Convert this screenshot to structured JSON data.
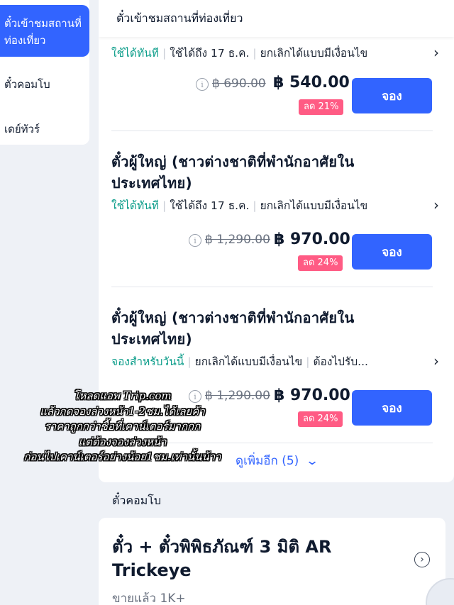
{
  "sidebar": {
    "items": [
      {
        "label": "ตั๋วเข้าชมสถานที่ท่องเที่ยว",
        "active": true
      },
      {
        "label": "ตั๋วคอมโบ"
      },
      {
        "label": "เดย์ทัวร์"
      }
    ]
  },
  "main": {
    "header": "ตั๋วเข้าชมสถานที่ท่องเที่ยว",
    "tickets": [
      {
        "title": "",
        "status": "ใช้ได้ทันที",
        "meta1": "ใช้ได้ถึง 17 ธ.ค.",
        "meta2": "ยกเลิกได้แบบมีเงื่อนไข",
        "old_price": "฿ 690.00",
        "new_price": "฿ 540.00",
        "discount": "ลด 21%",
        "button": "จอง"
      },
      {
        "title_line1": "ตั๋วผู้ใหญ่ (ชาวต่างชาติที่พำนักอาศัยใน",
        "title_line2": "ประเทศไทย)",
        "status": "ใช้ได้ทันที",
        "meta1": "ใช้ได้ถึง 17 ธ.ค.",
        "meta2": "ยกเลิกได้แบบมีเงื่อนไข",
        "old_price": "฿ 1,290.00",
        "new_price": "฿ 970.00",
        "discount": "ลด 24%",
        "button": "จอง"
      },
      {
        "title_line1": "ตั๋วผู้ใหญ่ (ชาวต่างชาติที่พำนักอาศัยใน",
        "title_line2": "ประเทศไทย)",
        "status": "จองสำหรับวันนี้",
        "meta1": "ยกเลิกได้แบบมีเงื่อนไข",
        "meta2": "ต้องไปรับ...",
        "old_price": "฿ 1,290.00",
        "new_price": "฿ 970.00",
        "discount": "ลด 24%",
        "button": "จอง"
      }
    ],
    "more": "ดูเพิ่มอีก (5)"
  },
  "combo_section": {
    "title": "ตั๋วคอมโบ",
    "card": {
      "title_line1": "ตั๋ว + ตั๋วพิพิธภัณฑ์ 3 มิติ AR",
      "title_line2": "Trickeye",
      "sold": "ขายแล้ว 1K+"
    }
  },
  "caption": {
    "lines": [
      "โหลดแอพ Trip.com",
      "แล้วกดจองล่วงหน้า1-2ชม.ได้เลยค้า",
      "ราคาถูกกว่าซื้อที่เคาน์เตอร์มากกก",
      "แต่ต้องจองล่วงหน้า",
      "ก่อนไปเคาน์เตอร์อย่างน้อย1ชม.เท่านั้นน้าา"
    ]
  },
  "colors": {
    "accent": "#3264ff",
    "green": "#0e9e8b",
    "discount": "#ff5b84"
  }
}
